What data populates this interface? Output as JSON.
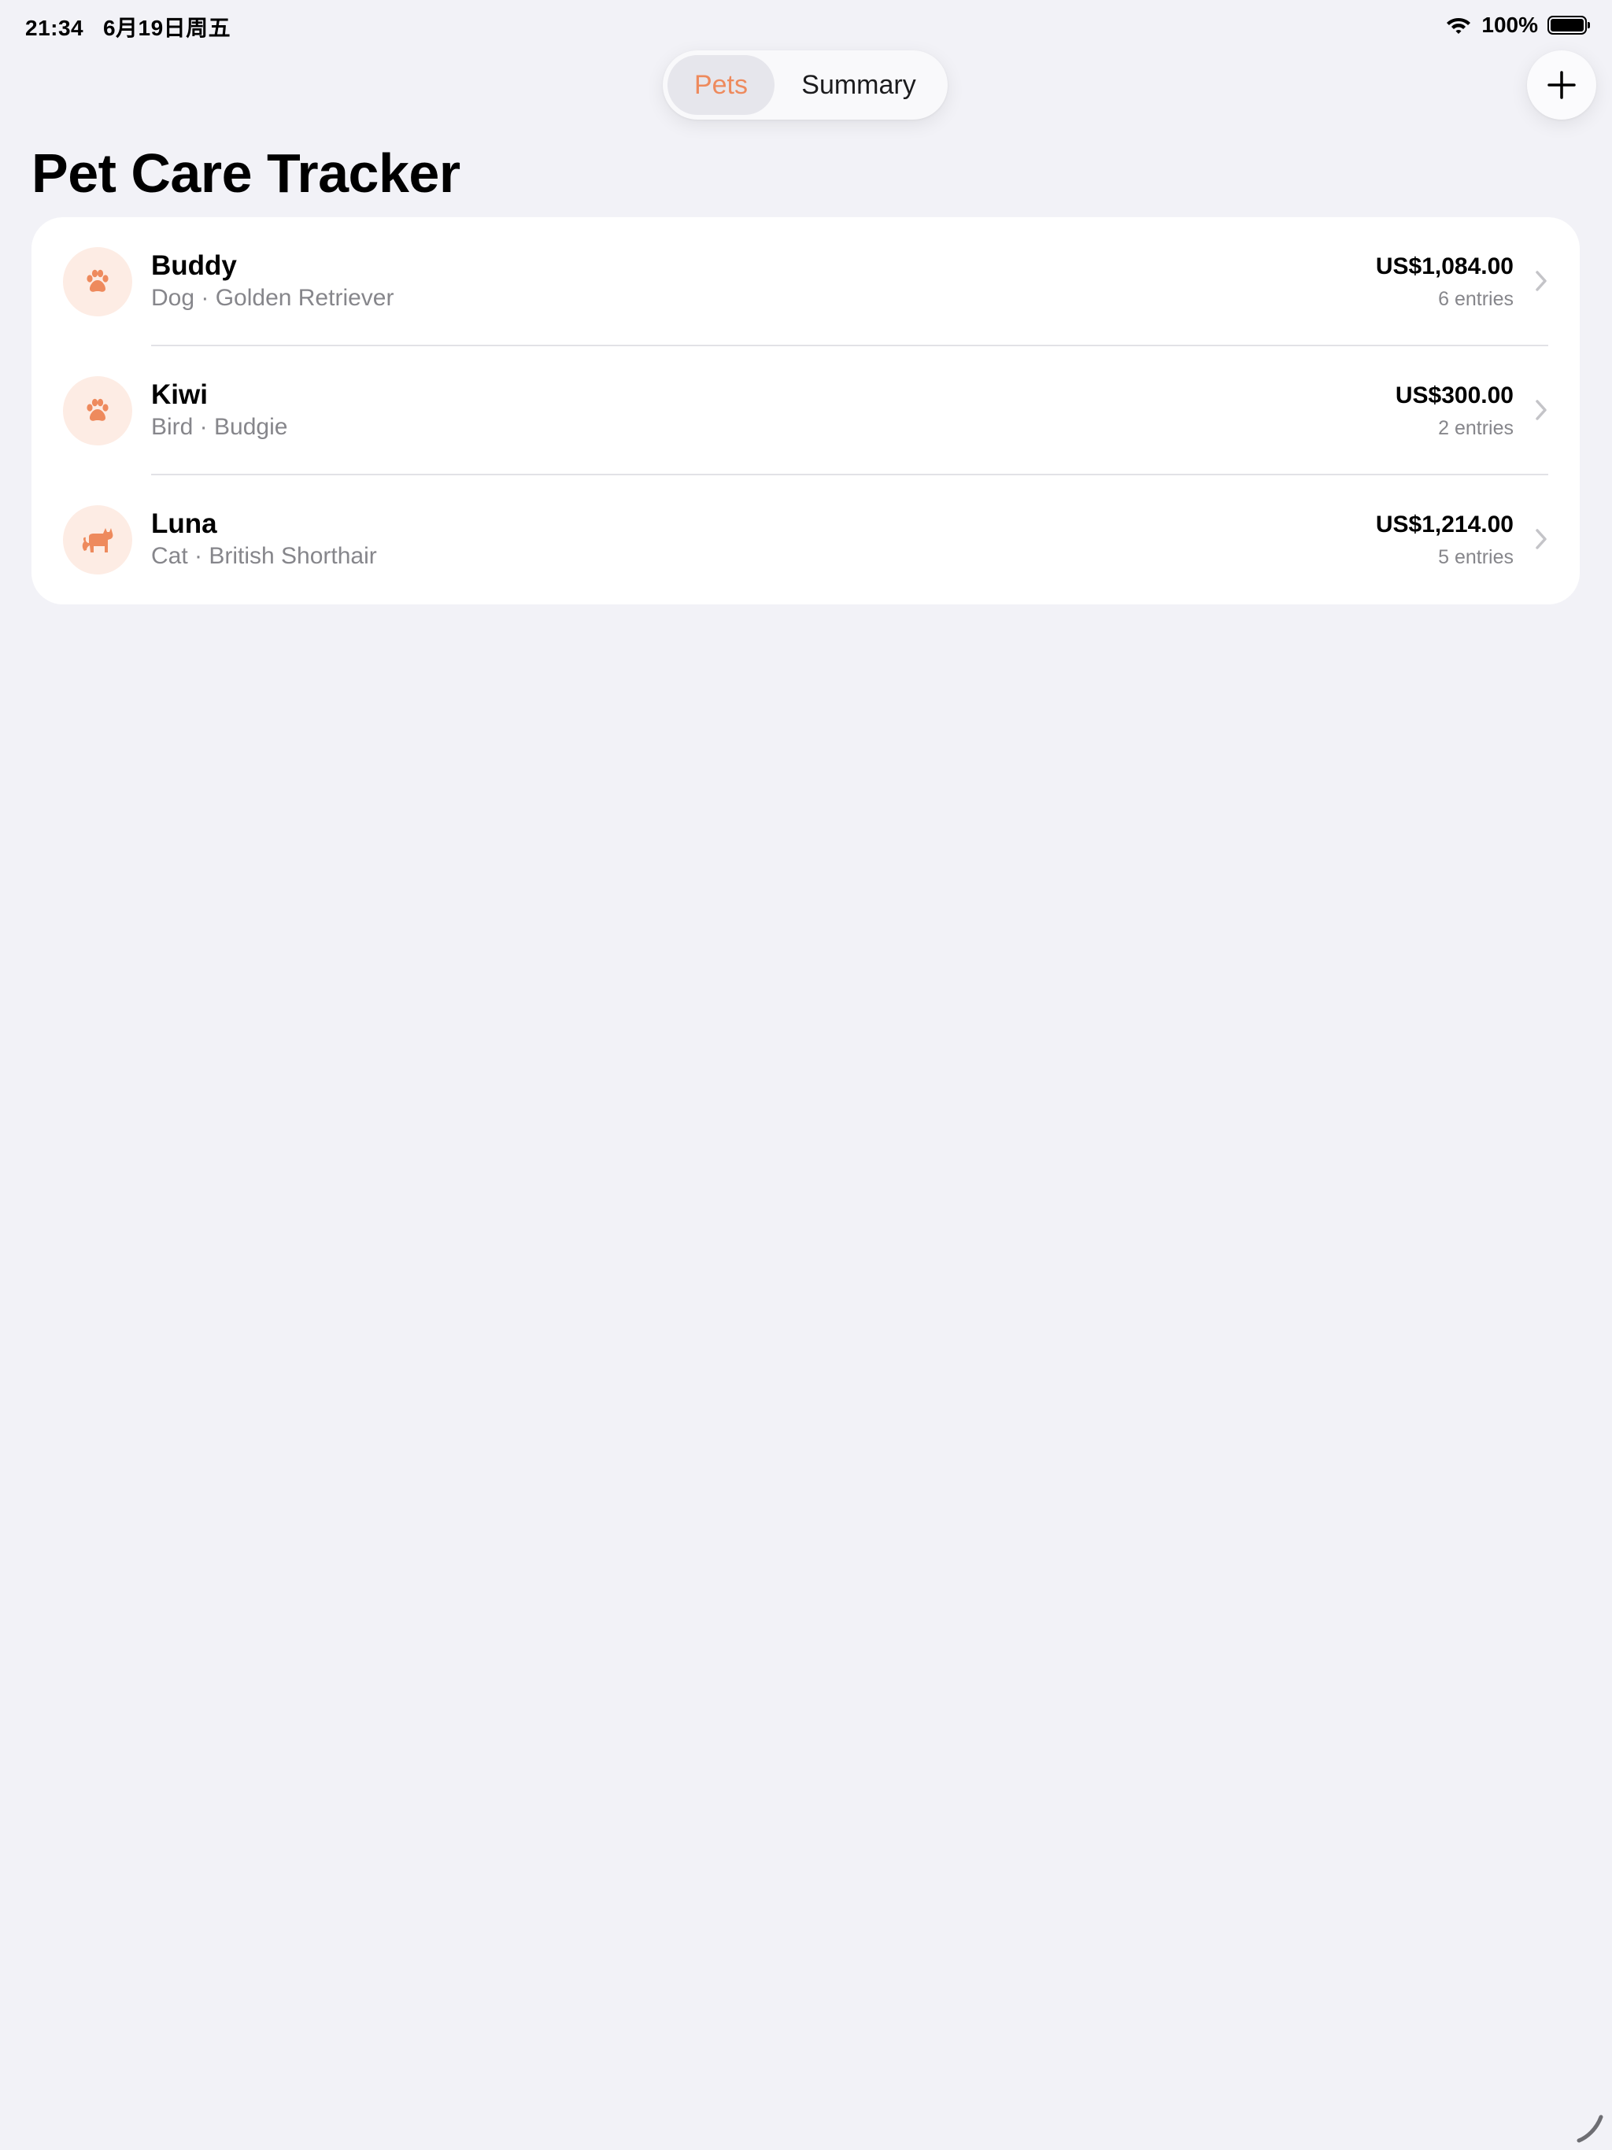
{
  "status_bar": {
    "time": "21:34",
    "date": "6月19日周五",
    "battery_percent": "100%",
    "battery_level": 1.0
  },
  "segmented_control": {
    "segments": [
      {
        "label": "Pets",
        "selected": true
      },
      {
        "label": "Summary",
        "selected": false
      }
    ]
  },
  "toolbar": {
    "add_icon": "plus-icon"
  },
  "page": {
    "title": "Pet Care Tracker"
  },
  "pets": [
    {
      "name": "Buddy",
      "subtitle": "Dog · Golden Retriever",
      "amount": "US$1,084.00",
      "entries": "6 entries",
      "icon": "paw-icon"
    },
    {
      "name": "Kiwi",
      "subtitle": "Bird · Budgie",
      "amount": "US$300.00",
      "entries": "2 entries",
      "icon": "paw-icon"
    },
    {
      "name": "Luna",
      "subtitle": "Cat · British Shorthair",
      "amount": "US$1,214.00",
      "entries": "5 entries",
      "icon": "cat-icon"
    }
  ],
  "colors": {
    "accent": "#ee8a5d",
    "avatar_bg": "#fdece4",
    "background": "#f2f2f7",
    "secondary_text": "#86868b"
  }
}
